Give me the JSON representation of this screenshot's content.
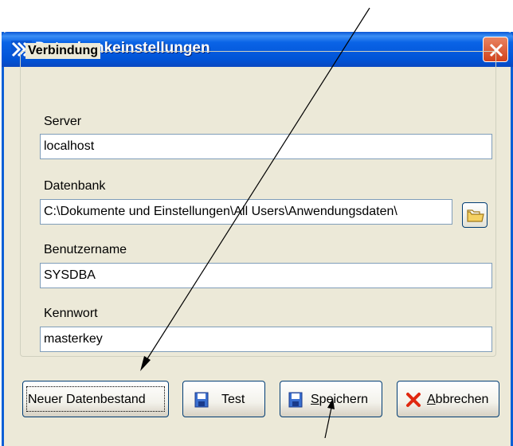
{
  "window": {
    "title": "Datenbankeinstellungen"
  },
  "group": {
    "title": "Verbindung"
  },
  "fields": {
    "server": {
      "label": "Server",
      "value": "localhost"
    },
    "datenbank": {
      "label": "Datenbank",
      "value": "C:\\Dokumente und Einstellungen\\All Users\\Anwendungsdaten\\"
    },
    "benutzername": {
      "label": "Benutzername",
      "value": "SYSDBA"
    },
    "kennwort": {
      "label": "Kennwort",
      "value": "masterkey"
    }
  },
  "buttons": {
    "neuer_datenbestand": "Neuer Datenbestand",
    "test": "Test",
    "speichern": {
      "first": "S",
      "rest": "peichern"
    },
    "abbrechen": {
      "first": "A",
      "rest": "bbrechen"
    }
  },
  "icons": {
    "app": "double-chevron-icon",
    "close": "close-icon",
    "browse": "folder-icon",
    "test": "floppy-disk-icon",
    "speichern": "floppy-disk-icon",
    "abbrechen": "red-x-icon"
  },
  "colors": {
    "titlebar": "#0053d6",
    "window_bg": "#ece9d8",
    "close_button": "#d2421c",
    "field_border": "#7f9db9",
    "button_border": "#003c74"
  }
}
